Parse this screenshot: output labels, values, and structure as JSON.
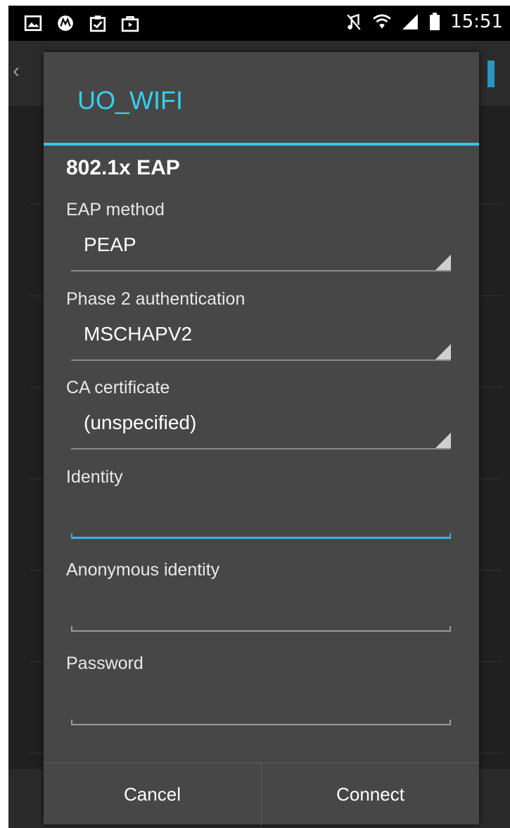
{
  "status_bar": {
    "time": "15:51",
    "left_icons": [
      "image-icon",
      "motorola-icon",
      "clipboard-check-icon",
      "shopping-bag-icon"
    ],
    "right_icons": [
      "mute-icon",
      "wifi-icon",
      "signal-icon",
      "battery-icon"
    ]
  },
  "dialog": {
    "title": "UO_WIFI",
    "security": "802.1x EAP",
    "eap_method": {
      "label": "EAP method",
      "value": "PEAP"
    },
    "phase2": {
      "label": "Phase 2 authentication",
      "value": "MSCHAPV2"
    },
    "ca_cert": {
      "label": "CA certificate",
      "value": "(unspecified)"
    },
    "identity": {
      "label": "Identity",
      "value": ""
    },
    "anonymous_identity": {
      "label": "Anonymous identity",
      "value": ""
    },
    "password": {
      "label": "Password",
      "value": ""
    },
    "buttons": {
      "cancel": "Cancel",
      "connect": "Connect"
    }
  },
  "colors": {
    "accent": "#33b5e5",
    "title": "#33d0f0",
    "dialog_bg": "#474747"
  }
}
